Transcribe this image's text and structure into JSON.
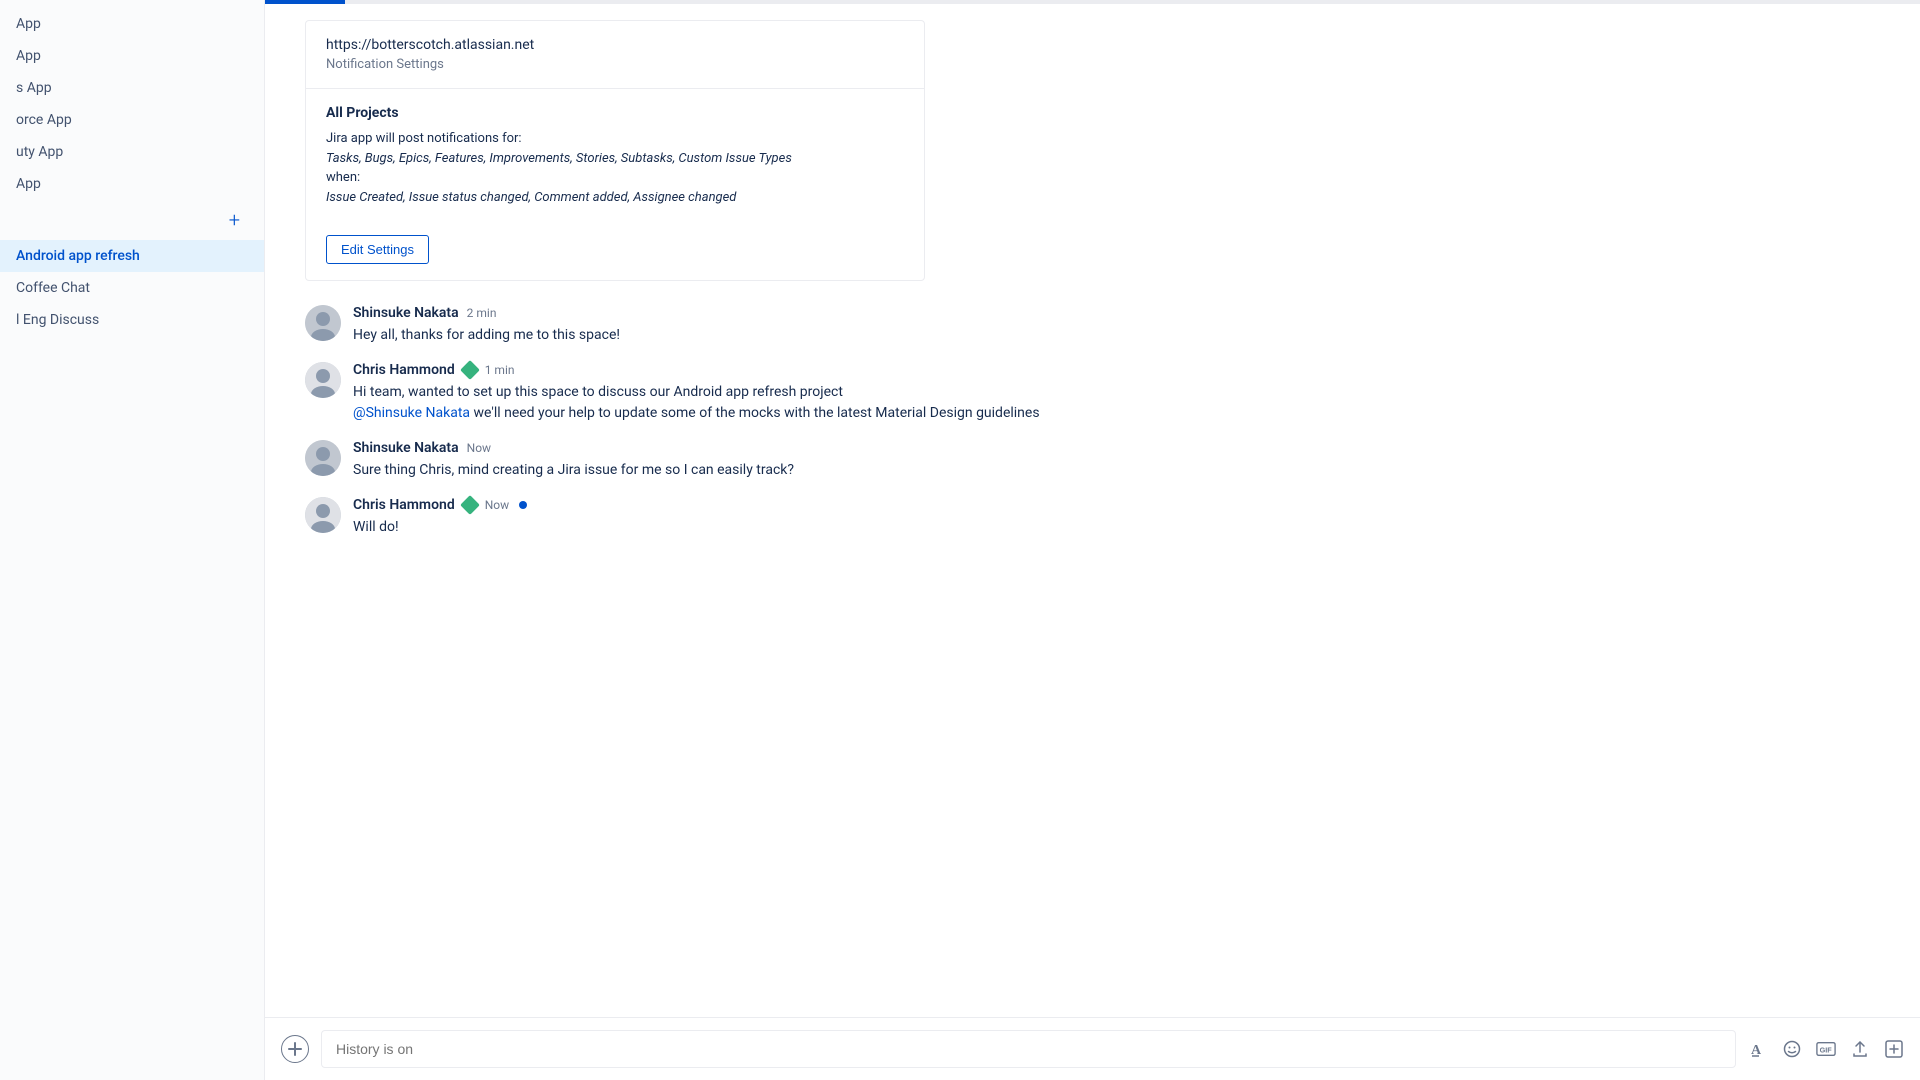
{
  "sidebar": {
    "add_button": "+",
    "items": [
      {
        "id": "app1",
        "label": "App",
        "badge": ""
      },
      {
        "id": "app2",
        "label": "App",
        "badge": ""
      },
      {
        "id": "app3",
        "label": "s App",
        "badge": ""
      },
      {
        "id": "app4",
        "label": "orce App",
        "badge": ""
      },
      {
        "id": "app5",
        "label": "uty App",
        "badge": ""
      },
      {
        "id": "app6",
        "label": "App",
        "badge": ""
      },
      {
        "id": "android-app-refresh",
        "label": "Android app refresh",
        "active": true
      },
      {
        "id": "coffee-chat",
        "label": "Coffee Chat",
        "active": false
      },
      {
        "id": "eng-discuss",
        "label": "l Eng Discuss",
        "active": false
      }
    ]
  },
  "notification_card": {
    "url": "https://botterscotch.atlassian.net",
    "subtitle": "Notification Settings",
    "all_projects_label": "All Projects",
    "description_line1": "Jira app will post notifications for:",
    "issue_types": "Tasks, Bugs, Epics, Features, Improvements, Stories, Subtasks, Custom Issue Types",
    "when_label": "when:",
    "events": "Issue Created, Issue status changed, Comment added, Assignee changed",
    "edit_button": "Edit Settings"
  },
  "messages": [
    {
      "id": "msg1",
      "author": "Shinsuke Nakata",
      "time": "2 min",
      "badge": false,
      "text": "Hey all, thanks for adding me to this space!",
      "mention": null,
      "text_after_mention": null
    },
    {
      "id": "msg2",
      "author": "Chris Hammond",
      "time": "1 min",
      "badge": true,
      "text": "Hi team, wanted to set up this space to discuss our Android app refresh project",
      "mention": "@Shinsuke Nakata",
      "text_after_mention": " we'll need your help to update some of the mocks with the latest Material Design guidelines"
    },
    {
      "id": "msg3",
      "author": "Shinsuke Nakata",
      "time": "Now",
      "badge": false,
      "text": "Sure thing Chris, mind creating a Jira issue for me so I can easily track?",
      "mention": null,
      "text_after_mention": null
    },
    {
      "id": "msg4",
      "author": "Chris Hammond",
      "time": "Now",
      "badge": true,
      "online": true,
      "text": "Will do!",
      "mention": null,
      "text_after_mention": null
    }
  ],
  "input": {
    "placeholder": "History is on"
  }
}
